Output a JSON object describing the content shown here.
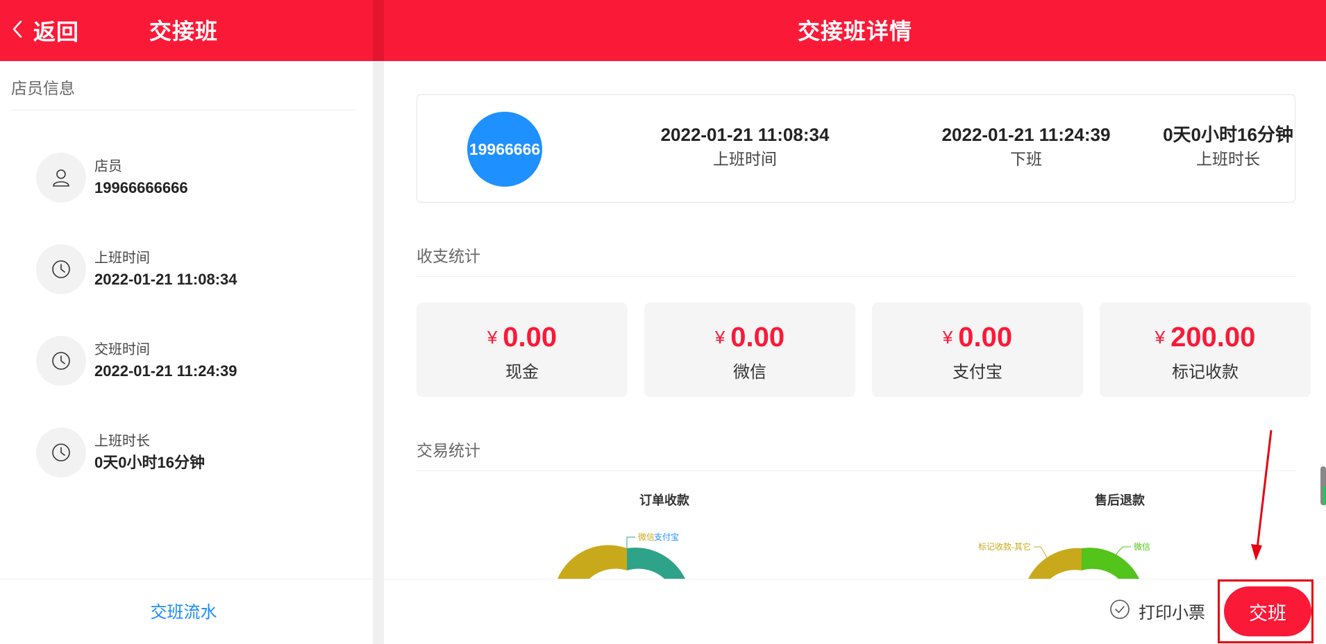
{
  "left_panel": {
    "back_label": "返回",
    "title": "交接班",
    "section_title": "店员信息",
    "items": [
      {
        "label": "店员",
        "value": "19966666666",
        "icon": "user-icon"
      },
      {
        "label": "上班时间",
        "value": "2022-01-21 11:08:34",
        "icon": "clock-icon"
      },
      {
        "label": "交班时间",
        "value": "2022-01-21 11:24:39",
        "icon": "clock-icon"
      },
      {
        "label": "上班时长",
        "value": "0天0小时16分钟",
        "icon": "clock-icon"
      }
    ],
    "footer_link": "交班流水"
  },
  "right_panel": {
    "title": "交接班详情",
    "summary": {
      "avatar_text": "19966666",
      "stats": [
        {
          "value": "2022-01-21 11:08:34",
          "label": "上班时间"
        },
        {
          "value": "2022-01-21 11:24:39",
          "label": "下班"
        },
        {
          "value": "0天0小时16分钟",
          "label": "上班时长"
        }
      ]
    },
    "income_section": {
      "title": "收支统计",
      "currency": "¥",
      "cards": [
        {
          "amount": "0.00",
          "label": "现金"
        },
        {
          "amount": "0.00",
          "label": "微信"
        },
        {
          "amount": "0.00",
          "label": "支付宝"
        },
        {
          "amount": "200.00",
          "label": "标记收款"
        }
      ]
    },
    "trade_section": {
      "title": "交易统计",
      "charts": [
        {
          "title": "订单收款",
          "legend_labels": [
            "微信",
            "支付宝"
          ]
        },
        {
          "title": "售后退款",
          "legend_labels": [
            "标记收款-其它",
            "微信"
          ]
        }
      ]
    },
    "bottom_bar": {
      "print_label": "打印小票",
      "handover_label": "交班"
    }
  },
  "colors": {
    "brand_red": "#fb1938",
    "avatar_blue": "#1e90ff",
    "link_blue": "#1989fa",
    "donut_yellow": "#c9a91c",
    "donut_teal": "#2fa38a",
    "donut_green": "#52c41a"
  }
}
